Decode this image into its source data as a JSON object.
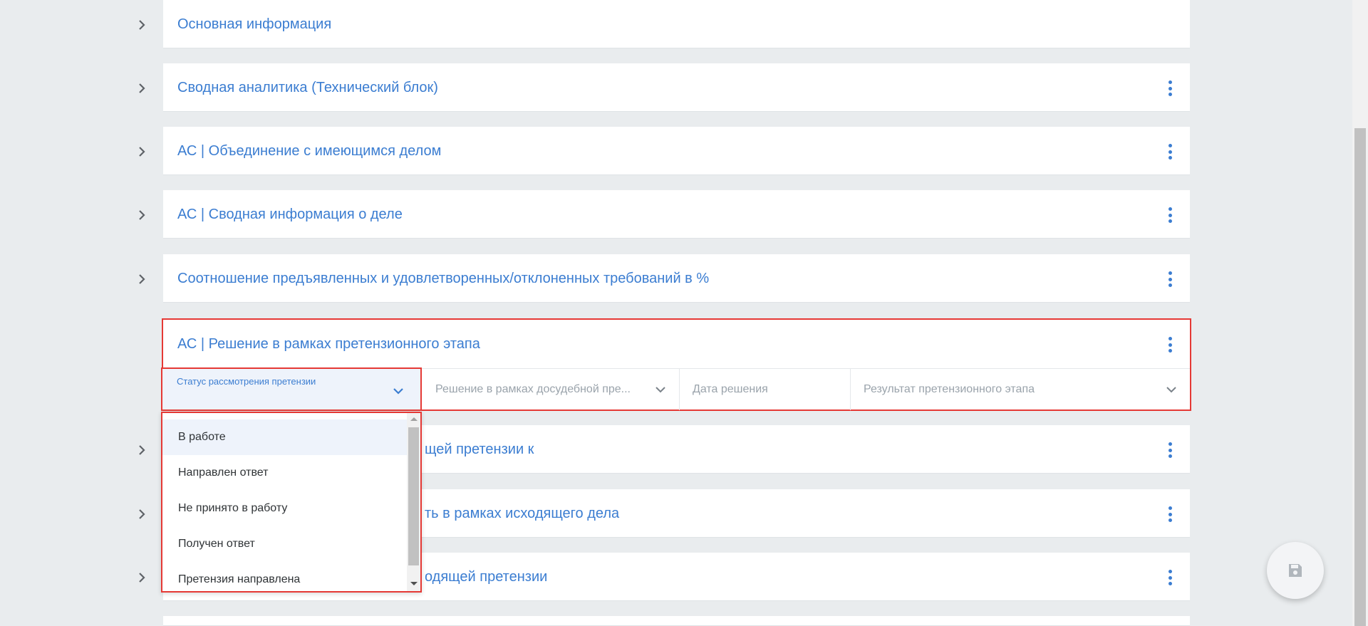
{
  "sections": [
    {
      "title": "Основная информация",
      "has_menu": false
    },
    {
      "title": "Сводная аналитика (Технический блок)",
      "has_menu": true
    },
    {
      "title": "АС | Объединение с имеющимся делом",
      "has_menu": true
    },
    {
      "title": "АС | Сводная информация о деле",
      "has_menu": true
    },
    {
      "title": "Соотношение предъявленных и удовлетворенных/отклоненных требований в %",
      "has_menu": true
    },
    {
      "title": "АС | Решение в рамках претензионного этапа",
      "has_menu": true,
      "expanded": true
    },
    {
      "title_visible_part": "щей претензии к",
      "has_menu": true
    },
    {
      "title_visible_part": "ть в рамках исходящего дела",
      "has_menu": true
    },
    {
      "title_visible_part": "одящей претензии",
      "has_menu": true
    }
  ],
  "expanded_section": {
    "fields": {
      "status": {
        "label": "Статус рассмотрения претензии",
        "value": ""
      },
      "decision": {
        "placeholder": "Решение в рамках досудебной пре..."
      },
      "decision_date": {
        "placeholder": "Дата решения"
      },
      "result": {
        "placeholder": "Результат претензионного этапа"
      }
    }
  },
  "status_dropdown": {
    "options": [
      "В работе",
      "Направлен ответ",
      "Не принято в работу",
      "Получен ответ",
      "Претензия направлена"
    ],
    "highlighted_index": 0
  },
  "icons": {
    "chevron": "chevron-right-icon",
    "menu": "kebab-menu-icon",
    "save": "save-icon"
  },
  "colors": {
    "accent": "#3b7dd1",
    "highlight_border": "#e53935",
    "background": "#e9ecee"
  }
}
